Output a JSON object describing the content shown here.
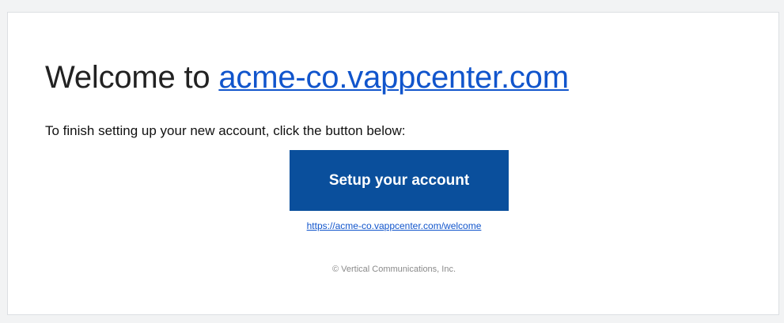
{
  "email": {
    "headline_prefix": "Welcome to ",
    "headline_link": "acme-co.vappcenter.com",
    "intro_text": "To finish setting up your new account, click the button below:",
    "cta_label": "Setup your account",
    "welcome_url": "https://acme-co.vappcenter.com/welcome",
    "footer_text": "© Vertical Communications, Inc."
  },
  "colors": {
    "background": "#f2f3f4",
    "card": "#ffffff",
    "cta_bg": "#0a4f9c",
    "link": "#1155cc",
    "footer_text": "#8a8a8a"
  }
}
